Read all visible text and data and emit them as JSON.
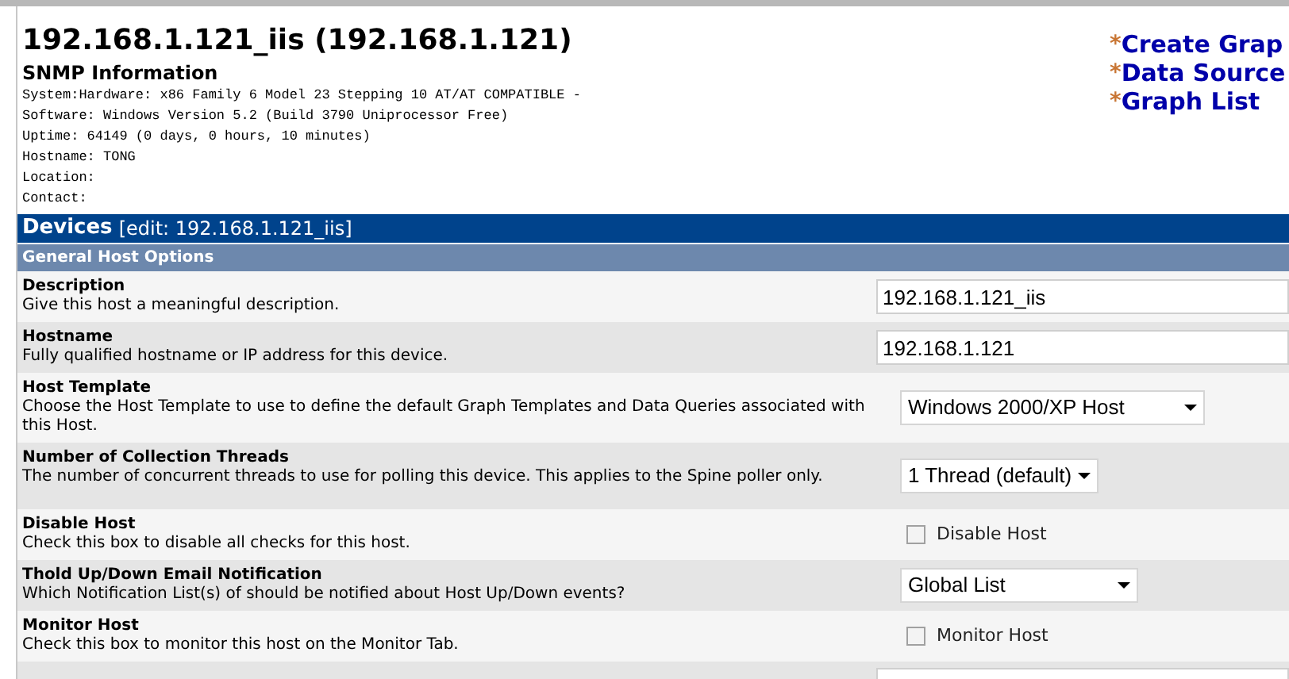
{
  "title": "192.168.1.121_iis (192.168.1.121)",
  "snmp": {
    "heading": "SNMP Information",
    "lines": [
      "System:Hardware: x86 Family 6 Model 23 Stepping 10 AT/AT COMPATIBLE -",
      "Software: Windows Version 5.2 (Build 3790 Uniprocessor Free)",
      "Uptime: 64149 (0 days, 0 hours, 10 minutes)",
      "Hostname: TONG",
      "Location:",
      "Contact:"
    ]
  },
  "links": [
    {
      "bullet": "*",
      "label": "Create Grap"
    },
    {
      "bullet": "*",
      "label": "Data Source"
    },
    {
      "bullet": "*",
      "label": "Graph List"
    }
  ],
  "panel": {
    "title": "Devices",
    "subtitle": "[edit: 192.168.1.121_iis]",
    "section": "General Host Options"
  },
  "rows": [
    {
      "kind": "text",
      "label": "Description",
      "help": "Give this host a meaningful description.",
      "value": "192.168.1.121_iis"
    },
    {
      "kind": "text",
      "label": "Hostname",
      "help": "Fully qualified hostname or IP address for this device.",
      "value": "192.168.1.121"
    },
    {
      "kind": "select",
      "label": "Host Template",
      "help": "Choose the Host Template to use to define the default Graph Templates and Data Queries associated with this Host.",
      "value": "Windows 2000/XP Host"
    },
    {
      "kind": "select",
      "label": "Number of Collection Threads",
      "help": "The number of concurrent threads to use for polling this device. This applies to the Spine poller only.",
      "value": "1 Thread (default)"
    },
    {
      "kind": "checkbox",
      "label": "Disable Host",
      "help": "Check this box to disable all checks for this host.",
      "caption": "Disable Host",
      "checked": false
    },
    {
      "kind": "select",
      "label": "Thold Up/Down Email Notification",
      "help": "Which Notification List(s) of should be notified about Host Up/Down events?",
      "value": "Global List"
    },
    {
      "kind": "checkbox",
      "label": "Monitor Host",
      "help": "Check this box to monitor this host on the Monitor Tab.",
      "caption": "Monitor Host",
      "checked": false
    },
    {
      "kind": "textarea"
    }
  ]
}
